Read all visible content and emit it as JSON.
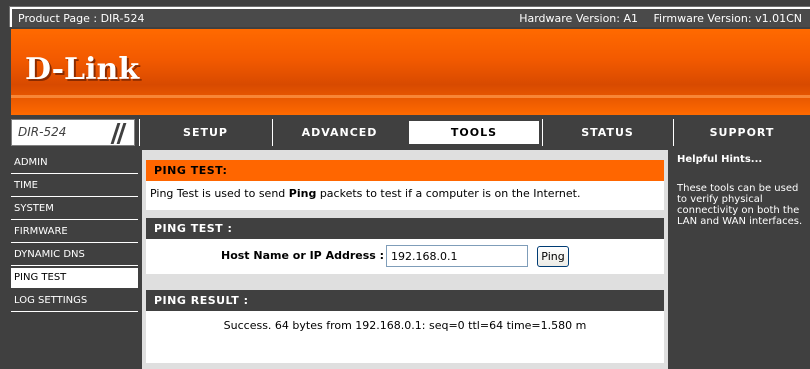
{
  "topbar": {
    "product": "Product Page : DIR-524",
    "hardware": "Hardware Version: A1",
    "firmware": "Firmware Version: v1.01CN"
  },
  "brand": {
    "logo": "D-Link",
    "accent": "#ff6600",
    "dark": "#404040"
  },
  "model": "DIR-524",
  "tabs": [
    {
      "label": "SETUP",
      "active": false
    },
    {
      "label": "ADVANCED",
      "active": false
    },
    {
      "label": "TOOLS",
      "active": true
    },
    {
      "label": "STATUS",
      "active": false
    },
    {
      "label": "SUPPORT",
      "active": false
    }
  ],
  "sidebar": {
    "items": [
      {
        "label": "ADMIN"
      },
      {
        "label": "TIME"
      },
      {
        "label": "SYSTEM"
      },
      {
        "label": "FIRMWARE"
      },
      {
        "label": "DYNAMIC DNS"
      },
      {
        "label": "PING TEST",
        "active": true
      },
      {
        "label": "LOG SETTINGS"
      }
    ]
  },
  "intro": {
    "title": "PING TEST:",
    "text_before": "Ping Test is used to send ",
    "text_bold": "Ping",
    "text_after": " packets to test if a computer is on the Internet."
  },
  "pingtest": {
    "title": "PING TEST :",
    "host_label": "Host Name or IP Address :",
    "host_value": "192.168.0.1",
    "button": "Ping"
  },
  "result": {
    "title": "PING RESULT :",
    "text": "Success. 64 bytes from 192.168.0.1: seq=0 ttl=64 time=1.580 m"
  },
  "hints": {
    "title": "Helpful Hints...",
    "text": "These tools can be used to verify physical connectivity on both the LAN and WAN interfaces."
  }
}
